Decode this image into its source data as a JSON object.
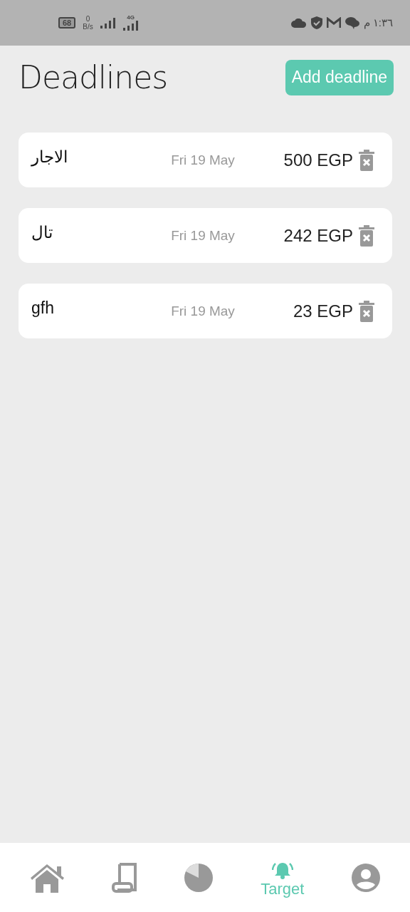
{
  "status_bar": {
    "battery": "68",
    "speed_value": "0",
    "speed_unit": "B/s",
    "network": "4G",
    "time": "١:٣٦ م"
  },
  "header": {
    "title": "Deadlines",
    "button": "Add deadline"
  },
  "deadlines": [
    {
      "name": "الاجار",
      "date": "Fri 19 May",
      "amount": "500 EGP"
    },
    {
      "name": "تال",
      "date": "Fri 19 May",
      "amount": "242 EGP"
    },
    {
      "name": "gfh",
      "date": "Fri 19 May",
      "amount": "23 EGP"
    }
  ],
  "bottom_nav": [
    {
      "kind": "home",
      "selected": false
    },
    {
      "kind": "receipt",
      "selected": false
    },
    {
      "kind": "pie",
      "selected": false
    },
    {
      "kind": "bell",
      "selected": true,
      "label": "Target"
    },
    {
      "kind": "profile",
      "selected": false
    }
  ]
}
